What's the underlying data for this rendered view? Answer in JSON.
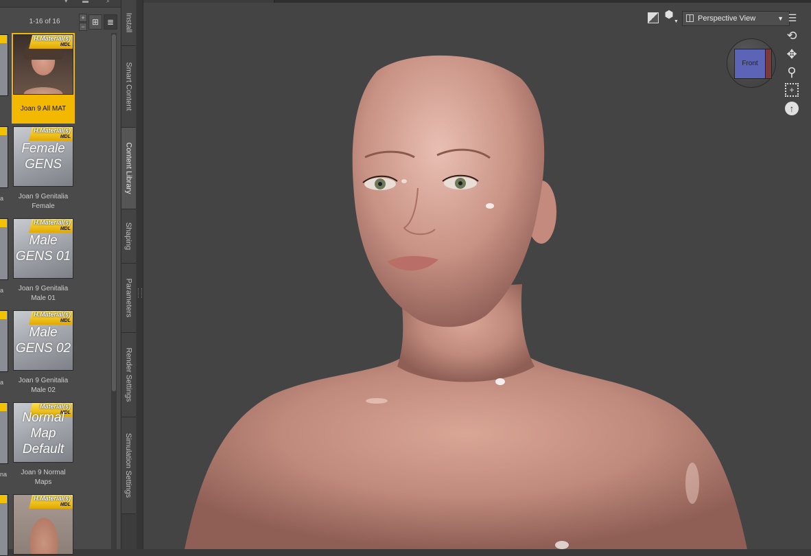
{
  "content_library": {
    "page_count": "1-16 of 16",
    "stepper_up": "+",
    "stepper_down": "−",
    "partial_labels": [
      "a",
      "a",
      "a",
      "nal"
    ],
    "items": [
      {
        "label": "Joan 9 All MAT",
        "badge_top": "H.Material(s)",
        "badge_bottom": "MDL",
        "thumb_text": "",
        "selected": true
      },
      {
        "label": "Joan 9 Genitalia Female",
        "badge_top": "H.Material(s)",
        "badge_bottom": "MDL",
        "thumb_text": "Female GENS",
        "selected": false
      },
      {
        "label": "Joan 9 Genitalia Male 01",
        "badge_top": "H.Material(s)",
        "badge_bottom": "MDL",
        "thumb_text": "Male GENS 01",
        "selected": false
      },
      {
        "label": "Joan 9 Genitalia Male 02",
        "badge_top": "H.Material(s)",
        "badge_bottom": "MDL",
        "thumb_text": "Male GENS 02",
        "selected": false
      },
      {
        "label": "Joan 9 Normal Maps",
        "badge_top": "Material(s)",
        "badge_bottom": "MDL",
        "thumb_text": "Normal Map Default",
        "selected": false
      },
      {
        "label": "",
        "badge_top": "H.Material(s)",
        "badge_bottom": "MDL",
        "thumb_text": "",
        "selected": false
      }
    ]
  },
  "side_tabs": [
    "Install",
    "Smart Content",
    "Content Library",
    "Shaping",
    "Parameters",
    "Render Settings",
    "Simulation Settings"
  ],
  "active_tab": "Content Library",
  "viewport": {
    "view_mode": "Perspective View",
    "view_cube_face": "Front",
    "dropdown_arrow": "▼",
    "icons": [
      "draw-style-icon",
      "shading-icon",
      "viewport-menu-icon",
      "orbit-icon",
      "pan-icon",
      "zoom-icon",
      "frame-icon",
      "reset-view-icon"
    ]
  },
  "colors": {
    "selected_tile": "#f3b800",
    "badge": "#ffd21f",
    "panel_bg": "#4a4a4a",
    "viewport_bg": "#444444",
    "cube_front": "#5c64b8"
  }
}
